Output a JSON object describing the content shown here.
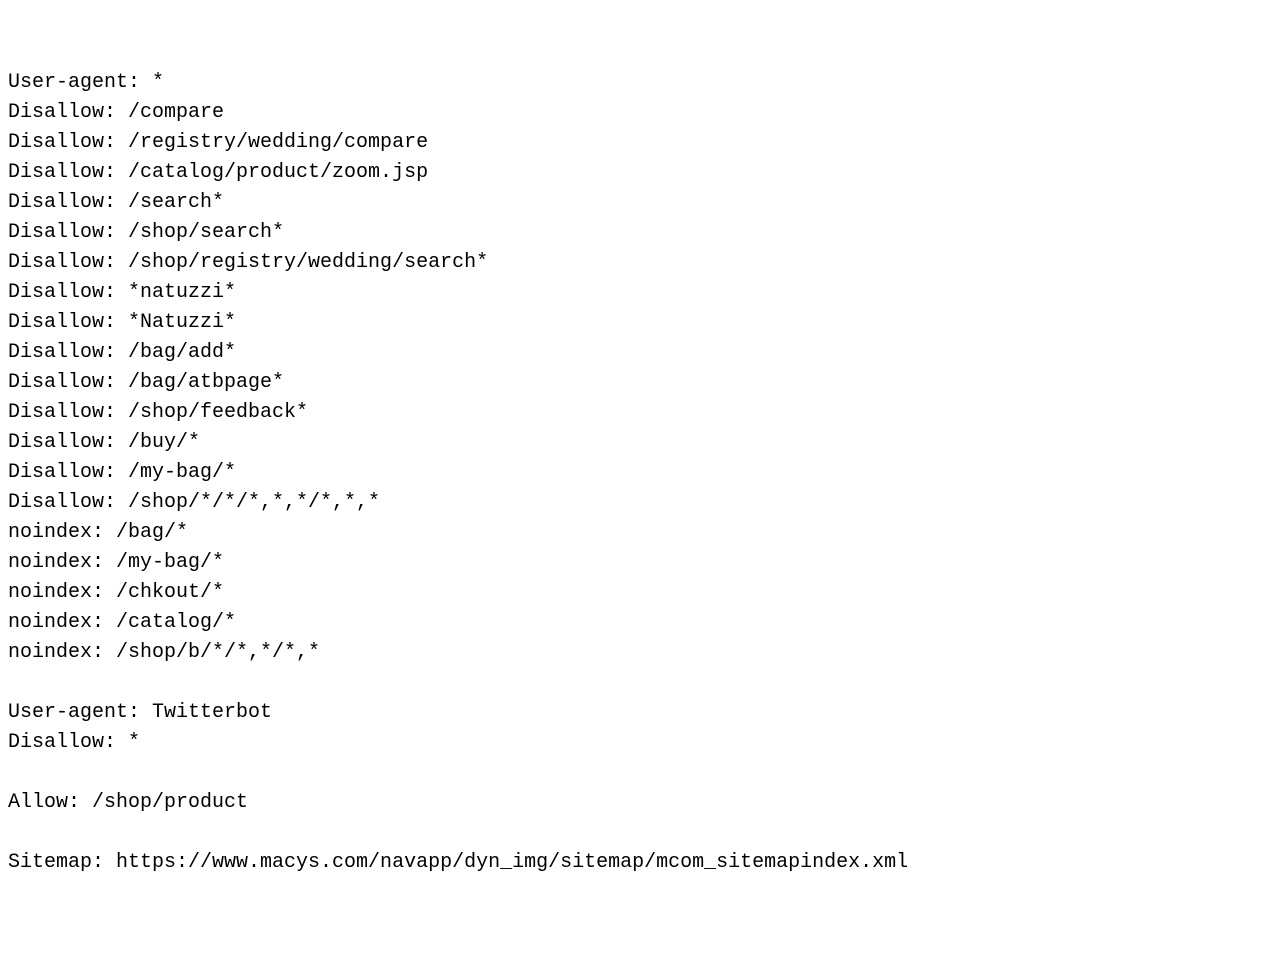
{
  "lines": [
    "User-agent: *",
    "Disallow: /compare",
    "Disallow: /registry/wedding/compare",
    "Disallow: /catalog/product/zoom.jsp",
    "Disallow: /search*",
    "Disallow: /shop/search*",
    "Disallow: /shop/registry/wedding/search*",
    "Disallow: *natuzzi*",
    "Disallow: *Natuzzi*",
    "Disallow: /bag/add*",
    "Disallow: /bag/atbpage*",
    "Disallow: /shop/feedback*",
    "Disallow: /buy/*",
    "Disallow: /my-bag/*",
    "Disallow: /shop/*/*/*,*,*/*,*,*",
    "noindex: /bag/*",
    "noindex: /my-bag/*",
    "noindex: /chkout/*",
    "noindex: /catalog/*",
    "noindex: /shop/b/*/*,*/*,*",
    "",
    "User-agent: Twitterbot",
    "Disallow: *",
    "",
    "Allow: /shop/product",
    "",
    "Sitemap: https://www.macys.com/navapp/dyn_img/sitemap/mcom_sitemapindex.xml"
  ]
}
